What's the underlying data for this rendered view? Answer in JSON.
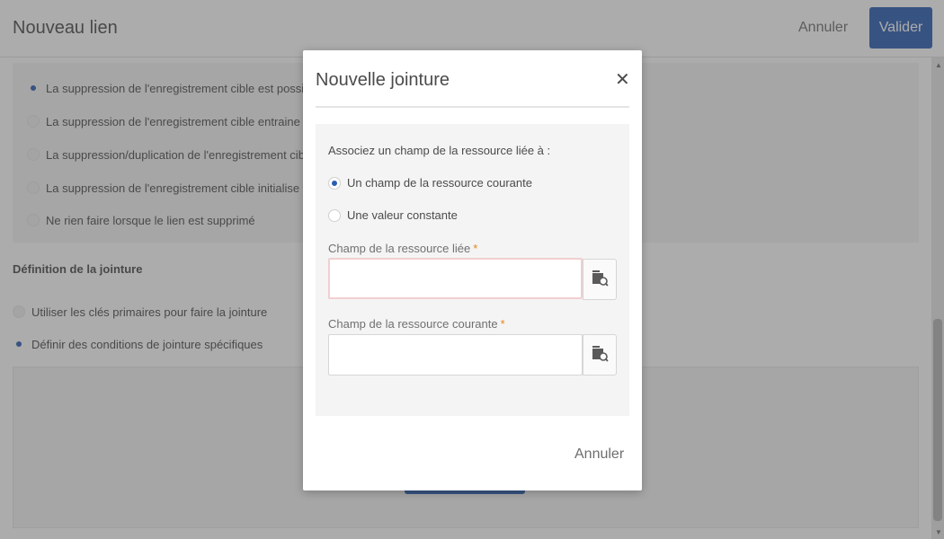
{
  "header": {
    "title": "Nouveau lien",
    "cancel_label": "Annuler",
    "validate_label": "Valider"
  },
  "deletion_options": [
    {
      "label": "La suppression de l'enregistrement cible est possible s'il n'",
      "selected": true
    },
    {
      "label": "La suppression de l'enregistrement cible entraine la suppr",
      "selected": false
    },
    {
      "label": "La suppression/duplication de l'enregistrement cible entra",
      "selected": false
    },
    {
      "label": "La suppression de l'enregistrement cible initialise les clés c",
      "selected": false
    },
    {
      "label": "Ne rien faire lorsque le lien est supprimé",
      "selected": false
    }
  ],
  "join_definition": {
    "title": "Définition de la jointure",
    "options": [
      {
        "label": "Utiliser les clés primaires pour faire la jointure",
        "selected": false
      },
      {
        "label": "Définir des conditions de jointure spécifiques",
        "selected": true
      }
    ]
  },
  "modal": {
    "title": "Nouvelle jointure",
    "close_icon": "close-icon",
    "prompt": "Associez un champ de la ressource liée à :",
    "radio_options": [
      {
        "label": "Un champ de la ressource courante",
        "selected": true
      },
      {
        "label": "Une valeur constante",
        "selected": false
      }
    ],
    "fields": [
      {
        "label": "Champ de la ressource liée",
        "required_mark": "*",
        "value": "",
        "icon": "field-picker-icon",
        "invalid": true
      },
      {
        "label": "Champ de la ressource courante",
        "required_mark": "*",
        "value": "",
        "icon": "field-picker-icon",
        "invalid": false
      }
    ],
    "cancel_label": "Annuler"
  },
  "colors": {
    "accent": "#2b5db3",
    "required": "#e68619",
    "invalid_border": "#f1cfcf"
  }
}
